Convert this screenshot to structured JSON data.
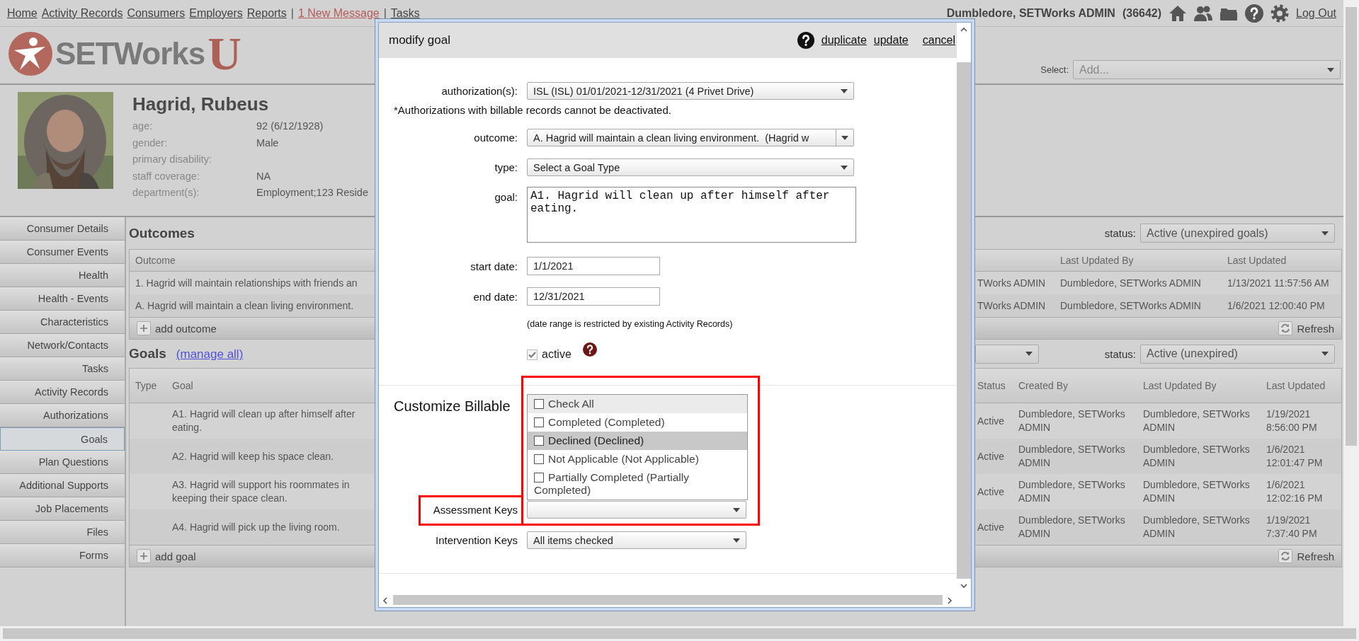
{
  "nav": [
    {
      "kind": "link",
      "label": "Home"
    },
    {
      "kind": "link",
      "label": "Activity Records"
    },
    {
      "kind": "link",
      "label": "Consumers"
    },
    {
      "kind": "link",
      "label": "Employers"
    },
    {
      "kind": "link",
      "label": "Reports"
    },
    {
      "kind": "sep",
      "label": "|"
    },
    {
      "kind": "alert",
      "label": "1 New Message"
    },
    {
      "kind": "sep",
      "label": "|"
    },
    {
      "kind": "link",
      "label": "Tasks"
    }
  ],
  "user": {
    "name": "Dumbledore, SETWorks ADMIN",
    "id": "(36642)",
    "logout": "Log Out"
  },
  "logo": {
    "text": "SETWorks",
    "mark": "U"
  },
  "add_select": {
    "label": "Select:",
    "placeholder": "Add..."
  },
  "consumer": {
    "name": "Hagrid, Rubeus",
    "fields": [
      {
        "label": "age:",
        "value": "92 (6/12/1928)"
      },
      {
        "label": "gender:",
        "value": "Male"
      },
      {
        "label": "primary disability:"
      },
      {
        "label": "staff coverage:",
        "value": "NA"
      },
      {
        "label": "department(s):",
        "value": "Employment;123 Reside"
      }
    ]
  },
  "sidebar": [
    {
      "label": "Consumer Details",
      "selected": false
    },
    {
      "label": "Consumer Events",
      "selected": false
    },
    {
      "label": "Health",
      "selected": false
    },
    {
      "label": "Health - Events",
      "selected": false
    },
    {
      "label": "Characteristics",
      "selected": false
    },
    {
      "label": "Network/Contacts",
      "selected": false
    },
    {
      "label": "Tasks",
      "selected": false
    },
    {
      "label": "Activity Records",
      "selected": false
    },
    {
      "label": "Authorizations",
      "selected": false
    },
    {
      "label": "Goals",
      "selected": true
    },
    {
      "label": "Plan Questions",
      "selected": false
    },
    {
      "label": "Additional Supports",
      "selected": false
    },
    {
      "label": "Job Placements",
      "selected": false
    },
    {
      "label": "Files",
      "selected": false
    },
    {
      "label": "Forms",
      "selected": false
    }
  ],
  "outcomes": {
    "title": "Outcomes",
    "status_label": "status:",
    "status": "Active (unexpired goals)",
    "columns": [
      "Outcome"
    ],
    "columns_right": [
      "Last Updated By",
      "Last Updated"
    ],
    "rows": [
      {
        "outcome": "1. Hagrid will maintain relationships with friends an",
        "column_2": "TWorks ADMIN",
        "last_updated_by": "Dumbledore, SETWorks ADMIN",
        "last_updated": "1/13/2021 11:57:56 AM"
      },
      {
        "outcome": "A. Hagrid will maintain a clean living environment.",
        "column_2": "TWorks ADMIN",
        "last_updated_by": "Dumbledore, SETWorks ADMIN",
        "last_updated": "1/6/2021 12:00:40 PM"
      }
    ],
    "add": "add outcome",
    "refresh": "Refresh"
  },
  "goals": {
    "title": "Goals",
    "manage": "(manage all)",
    "status_label": "status:",
    "status": "Active (unexpired)",
    "columns": [
      "Type",
      "Goal"
    ],
    "columns_right": [
      "Status",
      "Created By",
      "Last Updated By",
      "Last Updated"
    ],
    "rows": [
      {
        "goal": "A1. Hagrid will clean up after himself after eating.",
        "status": "Active",
        "created_by": "Dumbledore, SETWorks ADMIN",
        "last_updated_by": "Dumbledore, SETWorks ADMIN",
        "last_updated": "1/19/2021 8:56:00 PM"
      },
      {
        "goal": "A2. Hagrid will keep his space clean.",
        "status": "Active",
        "created_by": "Dumbledore, SETWorks ADMIN",
        "last_updated_by": "Dumbledore, SETWorks ADMIN",
        "last_updated": "1/6/2021 12:01:47 PM"
      },
      {
        "goal": "A3. Hagrid will support his roommates in keeping their space clean.",
        "status": "Active",
        "created_by": "Dumbledore, SETWorks ADMIN",
        "last_updated_by": "Dumbledore, SETWorks ADMIN",
        "last_updated": "1/6/2021 12:02:16 PM"
      },
      {
        "goal": "A4. Hagrid will pick up the living room.",
        "status": "Active",
        "created_by": "Dumbledore, SETWorks ADMIN",
        "last_updated_by": "Dumbledore, SETWorks ADMIN",
        "last_updated": "1/19/2021 7:37:40 PM"
      }
    ],
    "add": "add goal",
    "refresh": "Refresh"
  },
  "modal": {
    "title": "modify goal",
    "actions": [
      "duplicate",
      "update",
      "cancel"
    ],
    "authorization": {
      "label": "authorization(s):",
      "value": "ISL (ISL) 01/01/2021-12/31/2021 (4 Privet Drive)"
    },
    "note": "*Authorizations with billable records cannot be deactivated.",
    "outcome": {
      "label": "outcome:",
      "value": "A. Hagrid will maintain a clean living environment.  (Hagrid w"
    },
    "type": {
      "label": "type:",
      "value": "Select a Goal Type"
    },
    "goal": {
      "label": "goal:",
      "value": "A1. Hagrid will clean up after himself after eating."
    },
    "start_date": {
      "label": "start date:",
      "value": "1/1/2021"
    },
    "end_date": {
      "label": "end date:",
      "value": "12/31/2021"
    },
    "date_note": "(date range is restricted by existing Activity Records)",
    "active": {
      "label": "active",
      "checked": true,
      "disabled": true
    },
    "billable_title": "Customize Billable",
    "assessment": {
      "label": "Assessment Keys",
      "options": [
        {
          "kind": "all",
          "label": "Check All",
          "checked": false,
          "highlighted": false
        },
        {
          "kind": "option",
          "label": "Completed (Completed)",
          "checked": false,
          "highlighted": false
        },
        {
          "kind": "option",
          "label": "Declined (Declined)",
          "checked": false,
          "highlighted": true
        },
        {
          "kind": "option",
          "label": "Not Applicable (Not Applicable)",
          "checked": false,
          "highlighted": false
        },
        {
          "kind": "option",
          "label": "Partially Completed (Partially Completed)",
          "checked": false,
          "highlighted": false
        }
      ]
    },
    "intervention": {
      "label": "Intervention Keys",
      "value": "All items checked"
    }
  }
}
